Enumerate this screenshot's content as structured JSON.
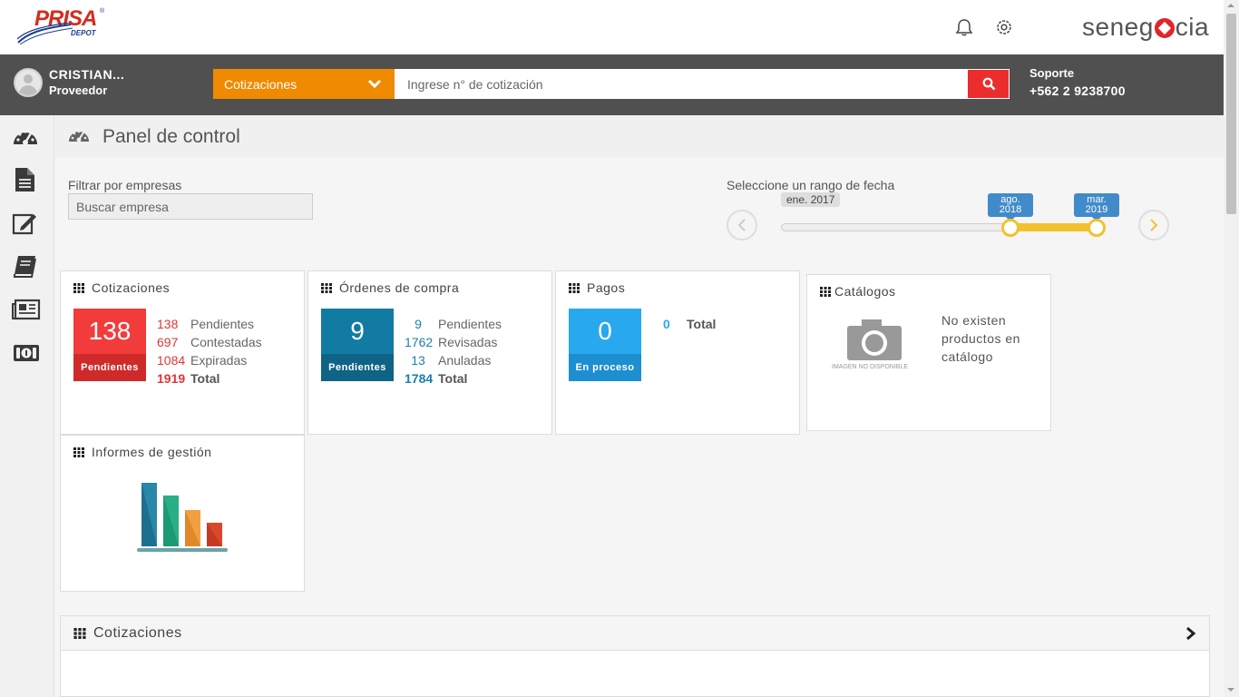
{
  "logo": {
    "word": "PRISA",
    "reg": "®",
    "sub": "DEPOT"
  },
  "brand": {
    "left": "sene",
    "mid": "g",
    "right": "cia"
  },
  "user": {
    "name": "CRISTIAN...",
    "role": "Proveedor"
  },
  "search": {
    "type": "Cotizaciones",
    "placeholder": "Ingrese n° de cotización"
  },
  "support": {
    "label": "Soporte",
    "phone": "+562 2 9238700"
  },
  "page_title": "Panel de control",
  "filter": {
    "label": "Filtrar por empresas",
    "placeholder": "Buscar empresa"
  },
  "range": {
    "label": "Seleccione un rango de fecha",
    "min": "ene. 2017",
    "from": [
      "ago.",
      "2018"
    ],
    "to": [
      "mar.",
      "2019"
    ]
  },
  "cards": {
    "cotizaciones": {
      "title": "Cotizaciones",
      "big": "138",
      "big_label": "Pendientes",
      "color": "#f23c3c",
      "label_color": "#cf2a2a",
      "rows": [
        {
          "n": "138",
          "t": "Pendientes"
        },
        {
          "n": "697",
          "t": "Contestadas"
        },
        {
          "n": "1084",
          "t": "Expiradas"
        },
        {
          "n": "1919",
          "t": "Total"
        }
      ]
    },
    "ordenes": {
      "title": "Órdenes de compra",
      "big": "9",
      "big_label": "Pendientes",
      "color": "#127ba3",
      "label_color": "#0e6386",
      "rows": [
        {
          "n": "9",
          "t": "Pendientes"
        },
        {
          "n": "1762",
          "t": "Revisadas"
        },
        {
          "n": "13",
          "t": "Anuladas"
        },
        {
          "n": "1784",
          "t": "Total"
        }
      ]
    },
    "pagos": {
      "title": "Pagos",
      "big": "0",
      "big_label": "En proceso",
      "color": "#27a8ef",
      "label_color": "#1d8fd0",
      "rows": [
        {
          "n": "0",
          "t": "Total"
        }
      ]
    },
    "catalogos": {
      "title": "Catálogos",
      "message": "No existen productos en catálogo",
      "no_image": "IMAGEN NO DISPONIBLE"
    },
    "informes": {
      "title": "Informes de gestión"
    }
  },
  "bottom_panel": {
    "title": "Cotizaciones"
  },
  "sidebar": [
    "dashboard-icon",
    "document-icon",
    "edit-icon",
    "book-icon",
    "newspaper-icon",
    "money-icon"
  ]
}
